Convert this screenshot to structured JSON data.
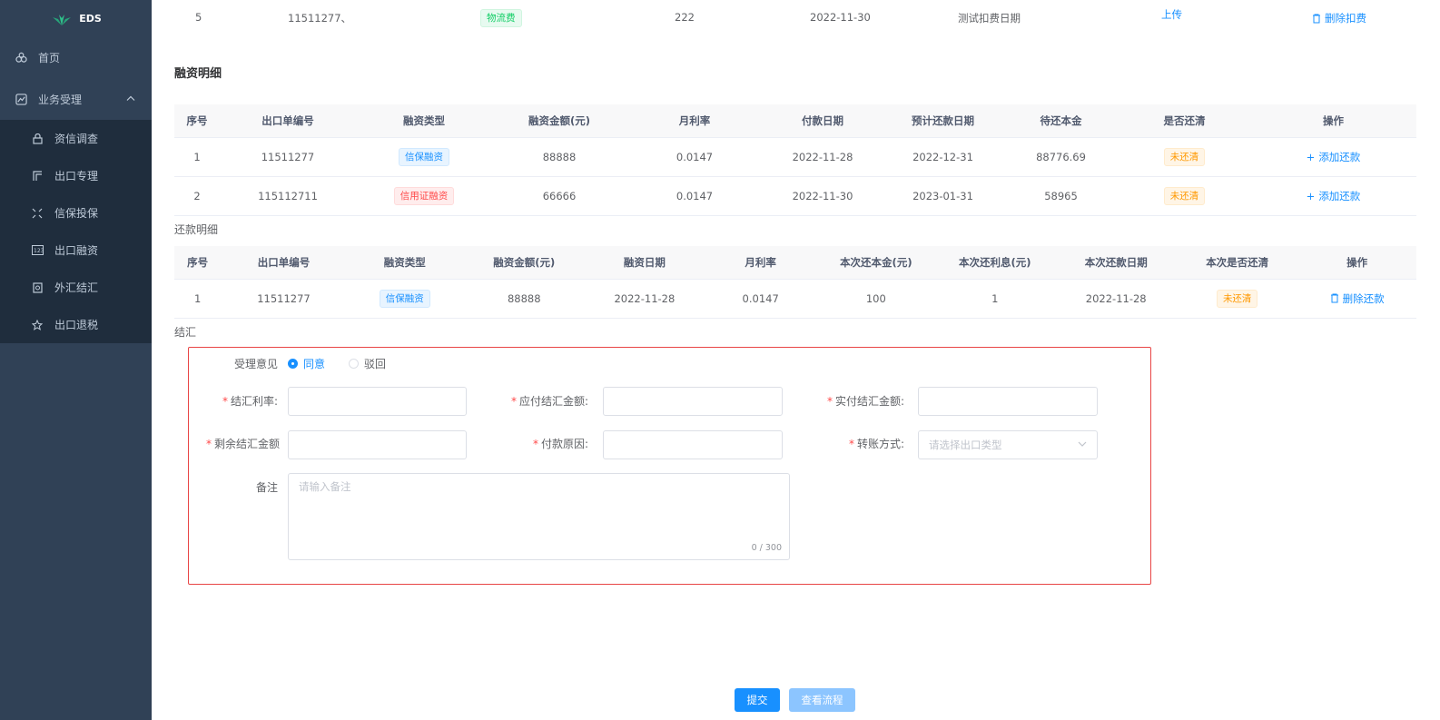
{
  "app": {
    "logo_text": "EDS"
  },
  "sidebar": {
    "home": "首页",
    "business": "业务受理",
    "sub_items": [
      {
        "label": "资信调查",
        "icon": "lock-icon"
      },
      {
        "label": "出口专理",
        "icon": "bracket-icon"
      },
      {
        "label": "信保投保",
        "icon": "compress-icon"
      },
      {
        "label": "出口融资",
        "icon": "number-icon"
      },
      {
        "label": "外汇结汇",
        "icon": "document-icon"
      },
      {
        "label": "出口退税",
        "icon": "star-icon"
      }
    ]
  },
  "top_row": {
    "index": "5",
    "order_no": "11511277、",
    "tag": "物流费",
    "amount": "222",
    "date": "2022-11-30",
    "desc": "测试扣费日期",
    "upload": "上传",
    "action": "删除扣费"
  },
  "financing": {
    "title": "融资明细",
    "headers": [
      "序号",
      "出口单编号",
      "融资类型",
      "融资金额(元)",
      "月利率",
      "付款日期",
      "预计还款日期",
      "待还本金",
      "是否还清",
      "操作"
    ],
    "rows": [
      {
        "index": "1",
        "order_no": "11511277",
        "type": "信保融资",
        "amount": "88888",
        "rate": "0.0147",
        "pay_date": "2022-11-28",
        "due_date": "2022-12-31",
        "principal": "88776.69",
        "status": "未还清",
        "action": "添加还款"
      },
      {
        "index": "2",
        "order_no": "115112711",
        "type": "信用证融资",
        "amount": "66666",
        "rate": "0.0147",
        "pay_date": "2022-11-30",
        "due_date": "2023-01-31",
        "principal": "58965",
        "status": "未还清",
        "action": "添加还款"
      }
    ]
  },
  "repayment": {
    "title": "还款明细",
    "headers": [
      "序号",
      "出口单编号",
      "融资类型",
      "融资金额(元)",
      "融资日期",
      "月利率",
      "本次还本金(元)",
      "本次还利息(元)",
      "本次还款日期",
      "本次是否还清",
      "操作"
    ],
    "rows": [
      {
        "index": "1",
        "order_no": "11511277",
        "type": "信保融资",
        "amount": "88888",
        "fin_date": "2022-11-28",
        "rate": "0.0147",
        "principal": "100",
        "interest": "1",
        "repay_date": "2022-11-28",
        "status": "未还清",
        "action": "删除还款"
      }
    ]
  },
  "settlement": {
    "title": "结汇",
    "opinion_label": "受理意见",
    "opinion_agree": "同意",
    "opinion_reject": "驳回",
    "rate_label": "结汇利率:",
    "due_amount_label": "应付结汇金额:",
    "paid_amount_label": "实付结汇金额:",
    "remain_label": "剩余结汇金额",
    "reason_label": "付款原因:",
    "transfer_label": "转账方式:",
    "transfer_placeholder": "请选择出口类型",
    "remark_label": "备注",
    "remark_placeholder": "请输入备注",
    "remark_counter": "0 / 300"
  },
  "buttons": {
    "submit": "提交",
    "view_flow": "查看流程"
  }
}
